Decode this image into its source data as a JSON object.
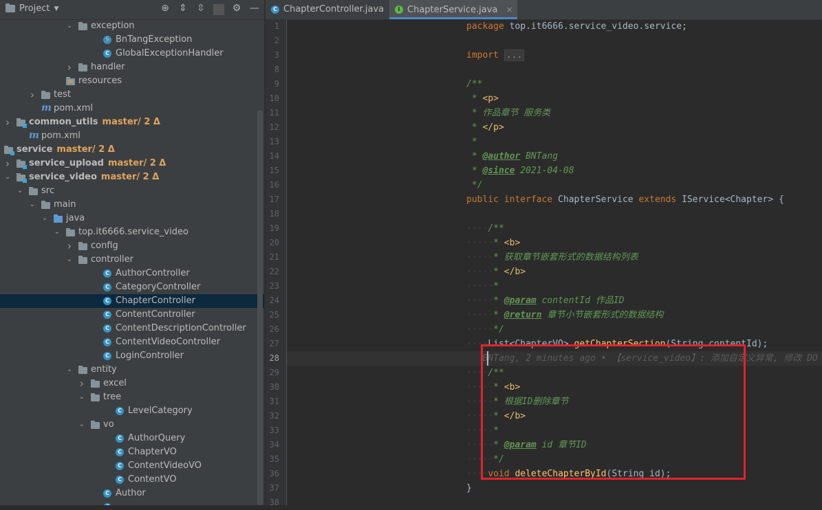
{
  "toolbar": {
    "project_label": "Project",
    "icons": [
      "target-icon",
      "expand-all-icon",
      "collapse-all-icon",
      "gear-icon",
      "minimize-icon"
    ]
  },
  "tree": [
    {
      "label": "exception",
      "type": "folder",
      "indent": 7,
      "expanded": true
    },
    {
      "label": "BnTangException",
      "type": "exception",
      "indent": 9
    },
    {
      "label": "GlobalExceptionHandler",
      "type": "class",
      "indent": 9
    },
    {
      "label": "handler",
      "type": "folder",
      "indent": 7,
      "expanded": false
    },
    {
      "label": "resources",
      "type": "resfolder",
      "indent": 6
    },
    {
      "label": "test",
      "type": "folder",
      "indent": 4,
      "expanded": false
    },
    {
      "label": "pom.xml",
      "type": "maven",
      "indent": 4
    },
    {
      "label": "common_utils",
      "type": "module",
      "indent": 2,
      "expanded": false,
      "bold": true,
      "branch": "master/ 2 Δ"
    },
    {
      "label": "pom.xml",
      "type": "maven",
      "indent": 3
    },
    {
      "label": "service",
      "type": "module",
      "indent": 1,
      "expanded": true,
      "bold": true,
      "branch": "master/ 2 Δ"
    },
    {
      "label": "service_upload",
      "type": "module",
      "indent": 2,
      "expanded": false,
      "bold": true,
      "branch": "master/ 2 Δ"
    },
    {
      "label": "service_video",
      "type": "module",
      "indent": 2,
      "expanded": true,
      "bold": true,
      "branch": "master/ 2 Δ"
    },
    {
      "label": "src",
      "type": "folder",
      "indent": 3,
      "expanded": true
    },
    {
      "label": "main",
      "type": "folder",
      "indent": 4,
      "expanded": true
    },
    {
      "label": "java",
      "type": "srcfolder",
      "indent": 5,
      "expanded": true
    },
    {
      "label": "top.it6666.service_video",
      "type": "folder",
      "indent": 6,
      "expanded": true
    },
    {
      "label": "config",
      "type": "folder",
      "indent": 7,
      "expanded": false
    },
    {
      "label": "controller",
      "type": "folder",
      "indent": 7,
      "expanded": true
    },
    {
      "label": "AuthorController",
      "type": "class",
      "indent": 9
    },
    {
      "label": "CategoryController",
      "type": "class",
      "indent": 9
    },
    {
      "label": "ChapterController",
      "type": "class",
      "indent": 9,
      "selected": true
    },
    {
      "label": "ContentController",
      "type": "class",
      "indent": 9
    },
    {
      "label": "ContentDescriptionController",
      "type": "class",
      "indent": 9
    },
    {
      "label": "ContentVideoController",
      "type": "class",
      "indent": 9
    },
    {
      "label": "LoginController",
      "type": "class",
      "indent": 9
    },
    {
      "label": "entity",
      "type": "folder",
      "indent": 7,
      "expanded": true
    },
    {
      "label": "excel",
      "type": "folder",
      "indent": 8,
      "expanded": false
    },
    {
      "label": "tree",
      "type": "folder",
      "indent": 8,
      "expanded": true
    },
    {
      "label": "LevelCategory",
      "type": "class",
      "indent": 10
    },
    {
      "label": "vo",
      "type": "folder",
      "indent": 8,
      "expanded": true
    },
    {
      "label": "AuthorQuery",
      "type": "class",
      "indent": 10
    },
    {
      "label": "ChapterVO",
      "type": "class",
      "indent": 10
    },
    {
      "label": "ContentVideoVO",
      "type": "class",
      "indent": 10
    },
    {
      "label": "ContentVO",
      "type": "class",
      "indent": 10
    },
    {
      "label": "Author",
      "type": "class",
      "indent": 9
    },
    {
      "label": "",
      "type": "class",
      "indent": 9
    }
  ],
  "tabs": [
    {
      "label": "ChapterController.java",
      "kind": "class",
      "active": false
    },
    {
      "label": "ChapterService.java",
      "kind": "interface",
      "active": true,
      "close": "×"
    }
  ],
  "editor": {
    "line_numbers": [
      "1",
      "2",
      "3",
      "8",
      "9",
      "10",
      "11",
      "12",
      "13",
      "14",
      "15",
      "16",
      "17",
      "18",
      "19",
      "20",
      "21",
      "22",
      "23",
      "24",
      "25",
      "26",
      "27",
      "28",
      "29",
      "30",
      "31",
      "32",
      "33",
      "34",
      "35",
      "36",
      "37",
      "38"
    ],
    "current_line": "28",
    "lines": [
      [
        [
          "kw",
          "package "
        ],
        [
          "pl",
          "top.it6666.service_video.service;"
        ]
      ],
      [],
      [
        [
          "kw",
          "import "
        ],
        [
          "fold",
          "..."
        ]
      ],
      [],
      [
        [
          "dc",
          "/**"
        ]
      ],
      [
        [
          "dc",
          " * "
        ],
        [
          "tag",
          "<p>"
        ]
      ],
      [
        [
          "dc",
          " * 作品章节 服务类"
        ]
      ],
      [
        [
          "dc",
          " * "
        ],
        [
          "tag",
          "</p>"
        ]
      ],
      [
        [
          "dc",
          " *"
        ]
      ],
      [
        [
          "dc",
          " * "
        ],
        [
          "doctag",
          "@author"
        ],
        [
          "dc",
          " BNTang"
        ]
      ],
      [
        [
          "dc",
          " * "
        ],
        [
          "doctag",
          "@since"
        ],
        [
          "dc",
          " 2021-04-08"
        ]
      ],
      [
        [
          "dc",
          " */"
        ]
      ],
      [
        [
          "kw",
          "public interface "
        ],
        [
          "pl",
          "ChapterService "
        ],
        [
          "kw",
          "extends "
        ],
        [
          "pl",
          "IService<Chapter> {"
        ]
      ],
      [],
      [
        [
          "ws",
          "····"
        ],
        [
          "dc",
          "/**"
        ]
      ],
      [
        [
          "ws",
          "·····"
        ],
        [
          "dc",
          "* "
        ],
        [
          "tag",
          "<b>"
        ]
      ],
      [
        [
          "ws",
          "·····"
        ],
        [
          "dc",
          "* 获取章节嵌套形式的数据结构列表"
        ]
      ],
      [
        [
          "ws",
          "·····"
        ],
        [
          "dc",
          "* "
        ],
        [
          "tag",
          "</b>"
        ]
      ],
      [
        [
          "ws",
          "·····"
        ],
        [
          "dc",
          "*"
        ]
      ],
      [
        [
          "ws",
          "·····"
        ],
        [
          "dc",
          "* "
        ],
        [
          "doctag",
          "@param"
        ],
        [
          "dc",
          " contentId 作品ID"
        ]
      ],
      [
        [
          "ws",
          "·····"
        ],
        [
          "dc",
          "* "
        ],
        [
          "doctag",
          "@return"
        ],
        [
          "dc",
          " 章节小节嵌套形式的数据结构"
        ]
      ],
      [
        [
          "ws",
          "·····"
        ],
        [
          "dc",
          "*/"
        ]
      ],
      [
        [
          "ws",
          "····"
        ],
        [
          "pl",
          "List<ChapterVO> "
        ],
        [
          "meth",
          "getChapterSection"
        ],
        [
          "pl",
          "(String contentId);"
        ]
      ],
      [
        [
          "blame",
          "   BNTang, 2 minutes ago • 【service_video】: 添加自定义异常, 修改 DO"
        ]
      ],
      [
        [
          "ws",
          "····"
        ],
        [
          "dc",
          "/**"
        ]
      ],
      [
        [
          "ws",
          "·····"
        ],
        [
          "dc",
          "* "
        ],
        [
          "tag",
          "<b>"
        ]
      ],
      [
        [
          "ws",
          "·····"
        ],
        [
          "dc",
          "* 根据ID删除章节"
        ]
      ],
      [
        [
          "ws",
          "·····"
        ],
        [
          "dc",
          "* "
        ],
        [
          "tag",
          "</b>"
        ]
      ],
      [
        [
          "ws",
          "·····"
        ],
        [
          "dc",
          "*"
        ]
      ],
      [
        [
          "ws",
          "·····"
        ],
        [
          "dc",
          "* "
        ],
        [
          "doctag",
          "@param"
        ],
        [
          "dc",
          " id 章节ID"
        ]
      ],
      [
        [
          "ws",
          "·····"
        ],
        [
          "dc",
          "*/"
        ]
      ],
      [
        [
          "ws",
          "····"
        ],
        [
          "kw",
          "void "
        ],
        [
          "meth",
          "deleteChapterById"
        ],
        [
          "pl",
          "(String id);"
        ]
      ],
      [
        [
          "pl",
          "}"
        ]
      ],
      []
    ]
  },
  "colors": {
    "highlight_box": "#e6222b",
    "branch": "#e0a55c",
    "selection": "#0d293e"
  }
}
